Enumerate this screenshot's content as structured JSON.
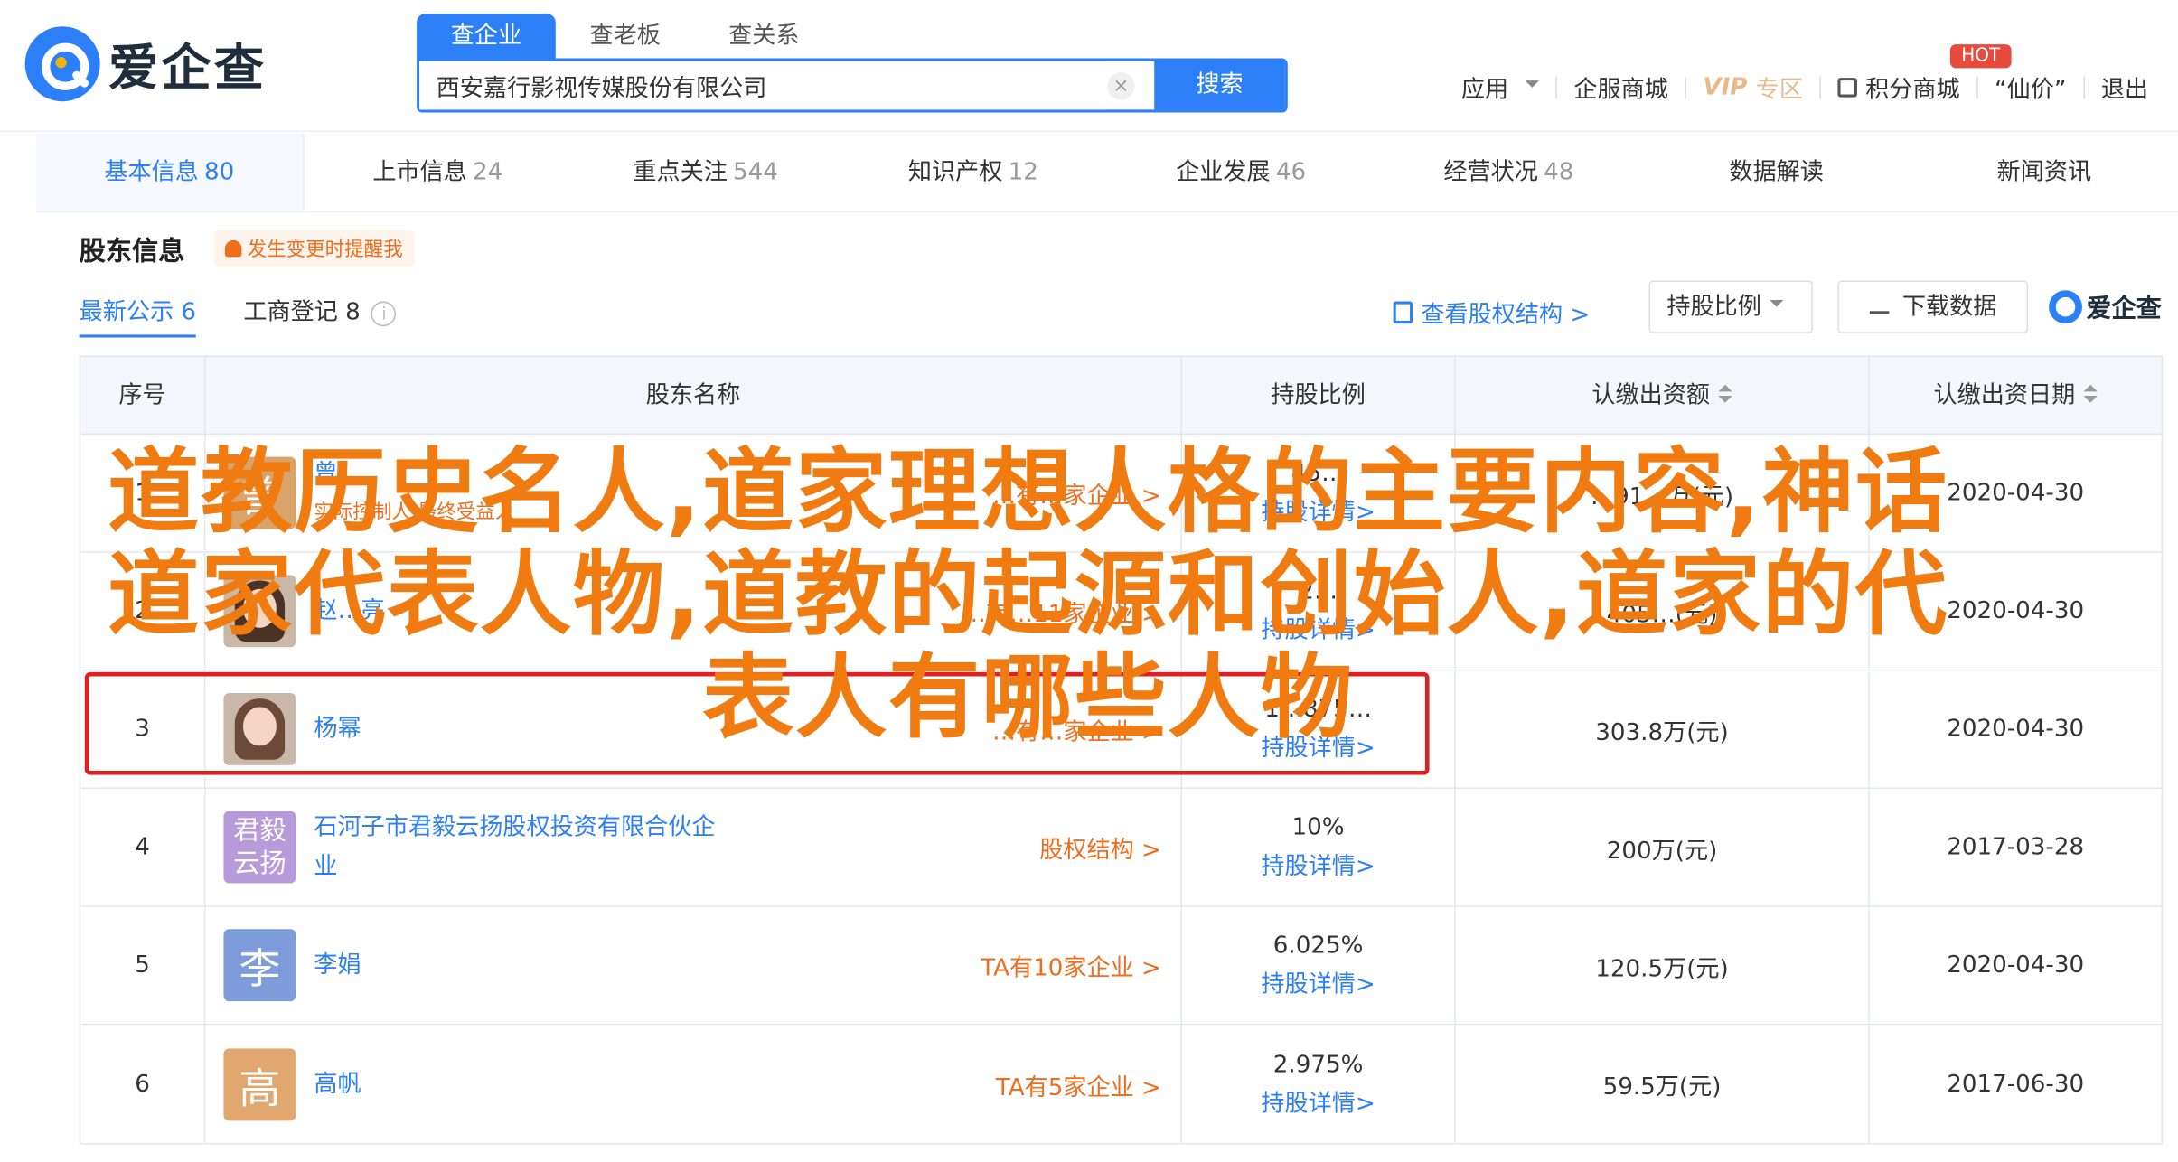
{
  "brand": {
    "name": "爱企查"
  },
  "search": {
    "tabs": [
      "查企业",
      "查老板",
      "查关系"
    ],
    "value": "西安嘉行影视传媒股份有限公司",
    "clear": "×",
    "button": "搜索"
  },
  "topnav": {
    "apps": "应用",
    "service_mall": "企服商城",
    "vip": "VIP",
    "vip_zone": "专区",
    "points_mall": "积分商城",
    "hot_badge": "HOT",
    "item5": "“仙价”",
    "logout": "退出"
  },
  "category_tabs": [
    {
      "label": "基本信息",
      "count": "80"
    },
    {
      "label": "上市信息",
      "count": "24"
    },
    {
      "label": "重点关注",
      "count": "544"
    },
    {
      "label": "知识产权",
      "count": "12"
    },
    {
      "label": "企业发展",
      "count": "46"
    },
    {
      "label": "经营状况",
      "count": "48"
    },
    {
      "label": "数据解读",
      "count": ""
    },
    {
      "label": "新闻资讯",
      "count": ""
    }
  ],
  "section": {
    "title": "股东信息",
    "alert": "发生变更时提醒我",
    "sub_tabs": [
      {
        "label": "最新公示",
        "count": "6"
      },
      {
        "label": "工商登记",
        "count": "8"
      }
    ],
    "info_glyph": "i",
    "equity_link": "查看股权结构 >",
    "ratio_select": "持股比例",
    "download": "下载数据",
    "brand_small": "爱企查"
  },
  "table": {
    "headers": [
      "序号",
      "股东名称",
      "持股比例",
      "认缴出资额",
      "认缴出资日期"
    ],
    "rows": [
      {
        "no": "1",
        "avatar": "曾",
        "avatar_color": "#d9a36a",
        "name": "曾…",
        "sub": "实际控制人 最终受益人",
        "link": "…有…家企业 >",
        "ratio": "45…",
        "detail": "持股详情>",
        "amount": "…91…万(元)",
        "date": "2020-04-30"
      },
      {
        "no": "2",
        "avatar": "",
        "avatar_color": "#c9b7a8",
        "name": "赵…亮",
        "sub": "",
        "link": "…有…11家企业 >",
        "ratio": "2…",
        "detail": "持股详情>",
        "amount": "405…(元)",
        "date": "2020-04-30"
      },
      {
        "no": "3",
        "avatar": "",
        "avatar_color": "#c9b7a8",
        "name": "杨幂",
        "sub": "",
        "link": "…有…家企业 >",
        "ratio": "1…875…",
        "detail": "持股详情>",
        "amount": "303.8万(元)",
        "date": "2020-04-30"
      },
      {
        "no": "4",
        "avatar": "君毅云扬",
        "avatar_color": "#b79ad9",
        "name": "石河子市君毅云扬股权投资有限合伙企业",
        "sub": "",
        "link": "股权结构 >",
        "ratio": "10%",
        "detail": "持股详情>",
        "amount": "200万(元)",
        "date": "2017-03-28"
      },
      {
        "no": "5",
        "avatar": "李",
        "avatar_color": "#7e9cd9",
        "name": "李娟",
        "sub": "",
        "link": "TA有10家企业 >",
        "ratio": "6.025%",
        "detail": "持股详情>",
        "amount": "120.5万(元)",
        "date": "2020-04-30"
      },
      {
        "no": "6",
        "avatar": "高",
        "avatar_color": "#e0a86e",
        "name": "高帆",
        "sub": "",
        "link": "TA有5家企业 >",
        "ratio": "2.975%",
        "detail": "持股详情>",
        "amount": "59.5万(元)",
        "date": "2017-06-30"
      }
    ]
  },
  "overlay": {
    "lines": [
      "道教历史名人,道家理想人格的主要内容,神话",
      "道家代表人物,道教的起源和创始人,道家的代",
      "表人有哪些人物"
    ]
  },
  "colors": {
    "accent": "#2c7ff6",
    "orange": "#f06d1e",
    "overlay": "#f07b10",
    "highlight": "#e02020"
  }
}
